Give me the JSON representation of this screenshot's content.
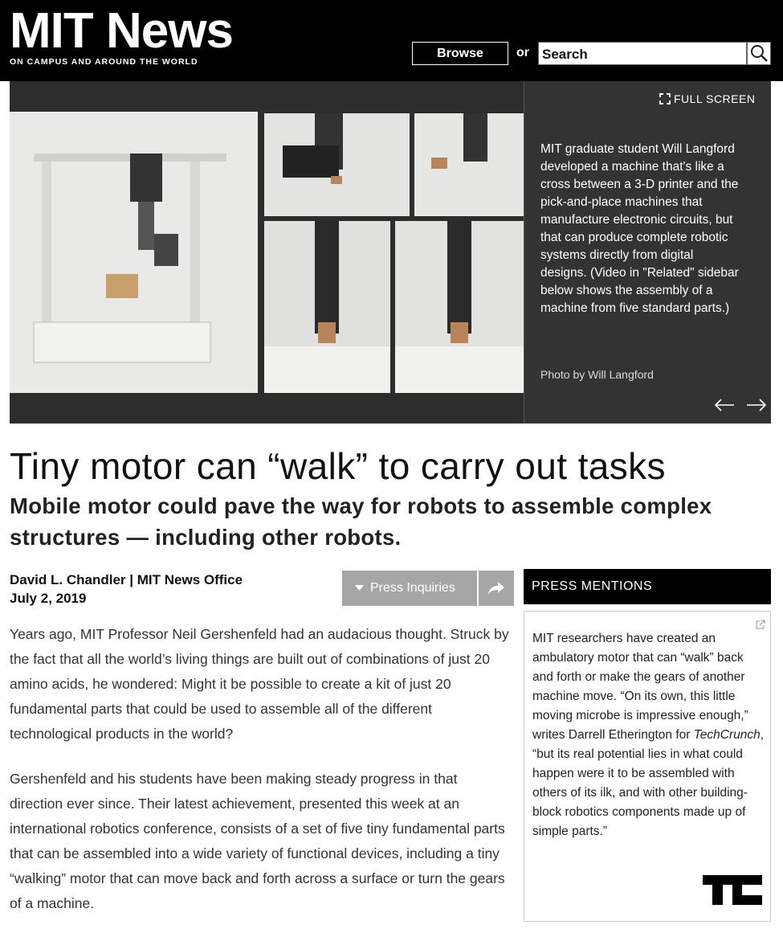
{
  "header": {
    "logo": "MIT News",
    "tagline": "ON CAMPUS AND AROUND THE WORLD",
    "browse_label": "Browse",
    "or_label": "or",
    "search_placeholder": "Search",
    "icons": {
      "search": "search-icon"
    }
  },
  "slideshow": {
    "fullscreen_label": "FULL SCREEN",
    "caption": "MIT graduate student Will Langford developed a machine that's like a cross between a 3-D printer and the pick-and-place machines that manufacture electronic circuits, but that can produce complete robotic systems directly from digital designs. (Video in \"Related\" sidebar below shows the assembly of a machine from five standard parts.)",
    "credit": "Photo by Will Langford",
    "icons": {
      "fullscreen": "fullscreen-icon",
      "prev": "arrow-left-icon",
      "next": "arrow-right-icon"
    }
  },
  "article": {
    "title": "Tiny motor can “walk” to carry out tasks",
    "subtitle": "Mobile motor could pave the way for robots to assemble complex structures — including other robots.",
    "author": "David L. Chandler",
    "separator": "|",
    "office": "MIT News Office",
    "date": "July 2, 2019",
    "press_inquiries_label": "Press Inquiries",
    "paragraphs": [
      "Years ago, MIT Professor Neil Gershenfeld had an audacious thought. Struck by the fact that all the world’s living things are built out of combinations of just 20 amino acids, he wondered: Might it be possible to create a kit of just 20 fundamental parts that could be used to assemble all of the different technological products in the world?",
      "Gershenfeld and his students have been making steady progress in that direction ever since. Their latest achievement, presented this week at an international robotics conference, consists of a set of five tiny fundamental parts that can be assembled into a wide variety of functional devices, including a tiny “walking” motor that can move back and forth across a surface or turn the gears of a machine."
    ]
  },
  "sidebar": {
    "press_mentions_label": "PRESS MENTIONS",
    "mention_text_before": "MIT researchers have created an ambulatory motor that can “walk” back and forth or make the gears of another machine move. “On its own, this little moving microbe is impressive enough,” writes Darrell Etherington for ",
    "mention_source": "TechCrunch",
    "mention_text_after": ", “but its real potential lies in what could happen were it to be assembled with others of its ilk, and with other building-block robotics components made up of simple parts.”",
    "source_logo": "TC",
    "icons": {
      "external": "external-link-icon",
      "share": "share-icon",
      "caret": "caret-down-icon"
    }
  }
}
